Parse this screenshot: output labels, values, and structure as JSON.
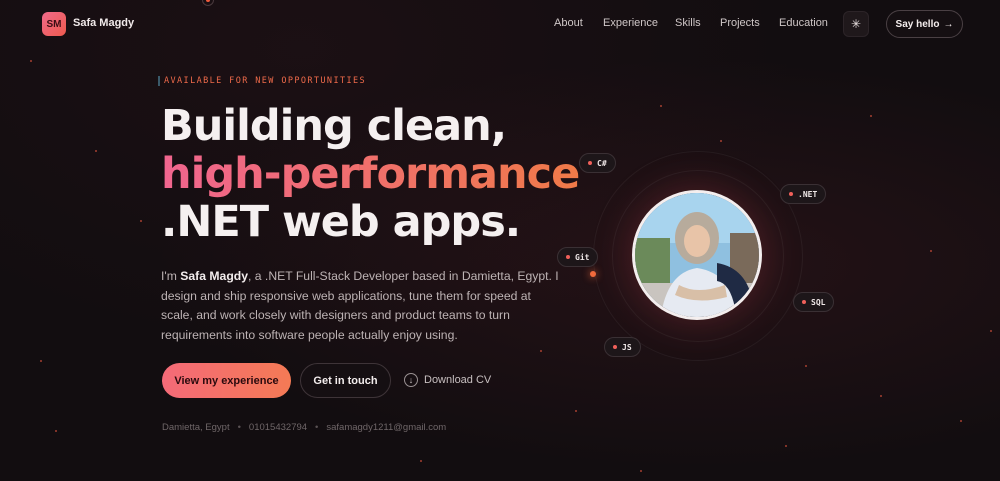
{
  "nav": {
    "logo_initials": "SM",
    "logo_name": "Safa Magdy",
    "links": [
      "About",
      "Experience",
      "Skills",
      "Projects",
      "Education"
    ],
    "theme_icon": "sun-icon",
    "cta_label": "Say hello",
    "cta_arrow": "→"
  },
  "hero": {
    "availability": "AVAILABLE FOR NEW OPPORTUNITIES",
    "headline_line1": "Building clean,",
    "headline_line2": "high-performance",
    "headline_line3": ".NET web apps.",
    "intro_prefix": "I'm ",
    "intro_name": "Safa Magdy",
    "intro_rest": ", a .NET Full-Stack Developer based in Damietta, Egypt. I design and ship responsive web applications, tune them for speed at scale, and work closely with designers and product teams to turn requirements into software people actually enjoy using.",
    "primary_button": "View my experience",
    "secondary_button": "Get in touch",
    "download_label": "Download CV",
    "contact": {
      "location": "Damietta, Egypt",
      "phone": "01015432794",
      "email": "safamagdy1211@gmail.com"
    }
  },
  "skills_tags": [
    "C#",
    ".NET",
    "Git",
    "SQL",
    "JS"
  ],
  "colors": {
    "accent_pink": "#f0658f",
    "accent_orange": "#f07a48",
    "background": "#120d10"
  }
}
